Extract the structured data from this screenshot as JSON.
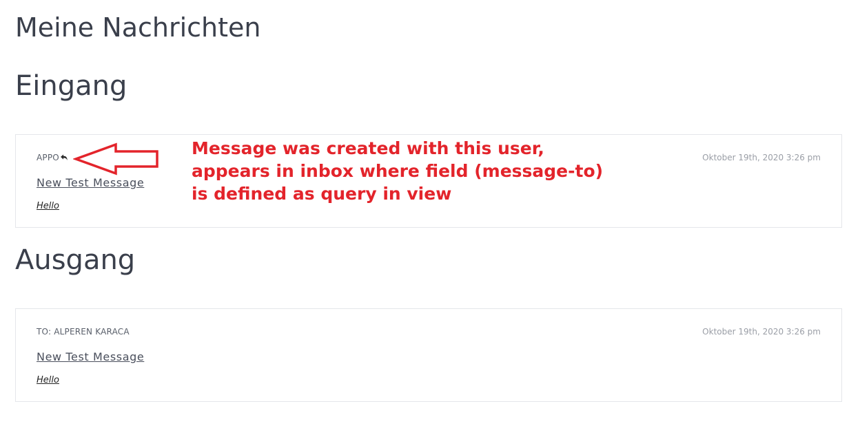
{
  "page": {
    "title": "Meine Nachrichten"
  },
  "inbox": {
    "heading": "Eingang",
    "messages": [
      {
        "sender": "APPO",
        "subject": "New Test Message",
        "body": "Hello",
        "date": "Oktober 19th, 2020 3:26 pm"
      }
    ]
  },
  "outbox": {
    "heading": "Ausgang",
    "messages": [
      {
        "recipient": "TO: ALPEREN KARACA",
        "subject": "New Test Message",
        "body": "Hello",
        "date": "Oktober 19th, 2020 3:26 pm"
      }
    ]
  },
  "annotation": {
    "color": "#e3242b",
    "lines": [
      "Message was created with this user,",
      "appears in inbox where field (message-to)",
      "is defined as query in view"
    ],
    "arrow_icon": "left-arrow-outline"
  },
  "icons": {
    "reply": "reply-arrow-icon"
  }
}
